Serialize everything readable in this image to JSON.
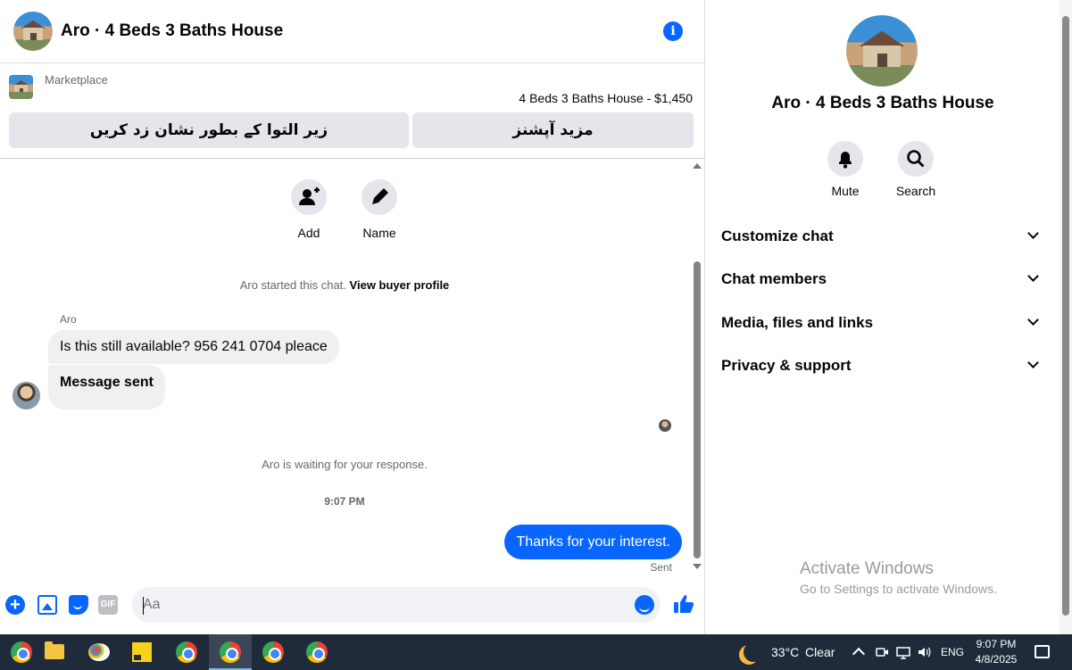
{
  "header": {
    "title": "Aro · 4 Beds 3 Baths House",
    "info_icon": "info-icon"
  },
  "listing": {
    "source": "Marketplace",
    "price_line": "4 Beds 3 Baths House - $1,450",
    "pin_button": "زیر التوا کے بطور نشان زد کریں",
    "more_button": "مزید آپشنز"
  },
  "quick_actions": {
    "add_label": "Add",
    "name_label": "Name"
  },
  "conversation": {
    "started_text": "Aro started this chat.",
    "view_profile_link": "View buyer profile",
    "sender_name": "Aro",
    "incoming": [
      "Is this still available? 956 241 0704 pleace",
      "Message sent"
    ],
    "waiting_text": "Aro is waiting for your response.",
    "timestamp": "9:07 PM",
    "outgoing": "Thanks for your interest.",
    "status": "Sent"
  },
  "composer": {
    "placeholder": "Aa",
    "gif_label": "GIF"
  },
  "details": {
    "title": "Aro · 4 Beds 3 Baths House",
    "mute_label": "Mute",
    "search_label": "Search",
    "sections": [
      "Customize chat",
      "Chat members",
      "Media, files and links",
      "Privacy & support"
    ]
  },
  "watermark": {
    "line1": "Activate Windows",
    "line2": "Go to Settings to activate Windows."
  },
  "taskbar": {
    "weather_temp": "33°C",
    "weather_desc": "Clear",
    "language": "ENG",
    "time": "9:07 PM",
    "date": "4/8/2025"
  },
  "colors": {
    "accent": "#0866ff",
    "bubble_in": "#f0f0f0",
    "button_bg": "#e4e6eb",
    "taskbar": "#1f2a3a"
  }
}
